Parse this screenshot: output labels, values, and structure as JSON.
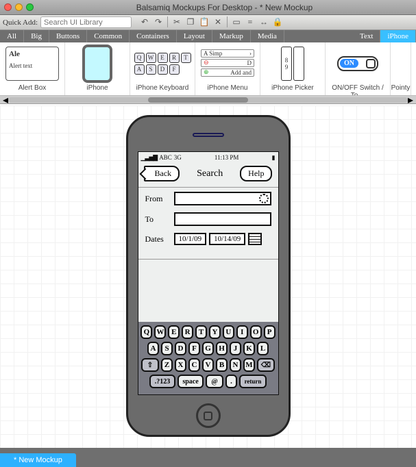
{
  "window": {
    "title": "Balsamiq Mockups For Desktop - * New Mockup"
  },
  "quickadd": {
    "label": "Quick Add:",
    "placeholder": "Search UI Library"
  },
  "categories": [
    "All",
    "Big",
    "Buttons",
    "Common",
    "Containers",
    "Layout",
    "Markup",
    "Media",
    "Text",
    "iPhone"
  ],
  "palette": {
    "alert": {
      "title": "Ale",
      "text": "Alert text",
      "caption": "Alert Box"
    },
    "iphone": {
      "caption": "iPhone"
    },
    "kbd": {
      "keys": [
        "Q",
        "W",
        "E",
        "R",
        "T",
        "A",
        "S",
        "D",
        "F"
      ],
      "caption": "iPhone Keyboard"
    },
    "menu": {
      "row1": "A Simp",
      "row2": "D",
      "row3": "Add and",
      "caption": "iPhone Menu"
    },
    "picker": {
      "a": "8",
      "b": "9",
      "caption": "iPhone Picker"
    },
    "switch": {
      "label": "ON",
      "caption": "ON/OFF Switch / To…"
    },
    "pointy": {
      "caption": "Pointy"
    }
  },
  "phone": {
    "carrier": "ABC",
    "net": "3G",
    "time": "11:13 PM",
    "back": "Back",
    "title": "Search",
    "help": "Help",
    "from": "From",
    "to": "To",
    "dates": "Dates",
    "date1": "10/1/09",
    "date2": "10/14/09"
  },
  "keyboard": {
    "r1": [
      "Q",
      "W",
      "E",
      "R",
      "T",
      "Y",
      "U",
      "I",
      "O",
      "P"
    ],
    "r2": [
      "A",
      "S",
      "D",
      "F",
      "G",
      "H",
      "J",
      "K",
      "L"
    ],
    "r3": [
      "Z",
      "X",
      "C",
      "V",
      "B",
      "N",
      "M"
    ],
    "shift": "⇧",
    "bksp": "⌫",
    "numkey": ".?123",
    "space": "space",
    "at": "@",
    "dot": ".",
    "ret": "return"
  },
  "filetab": "* New Mockup"
}
